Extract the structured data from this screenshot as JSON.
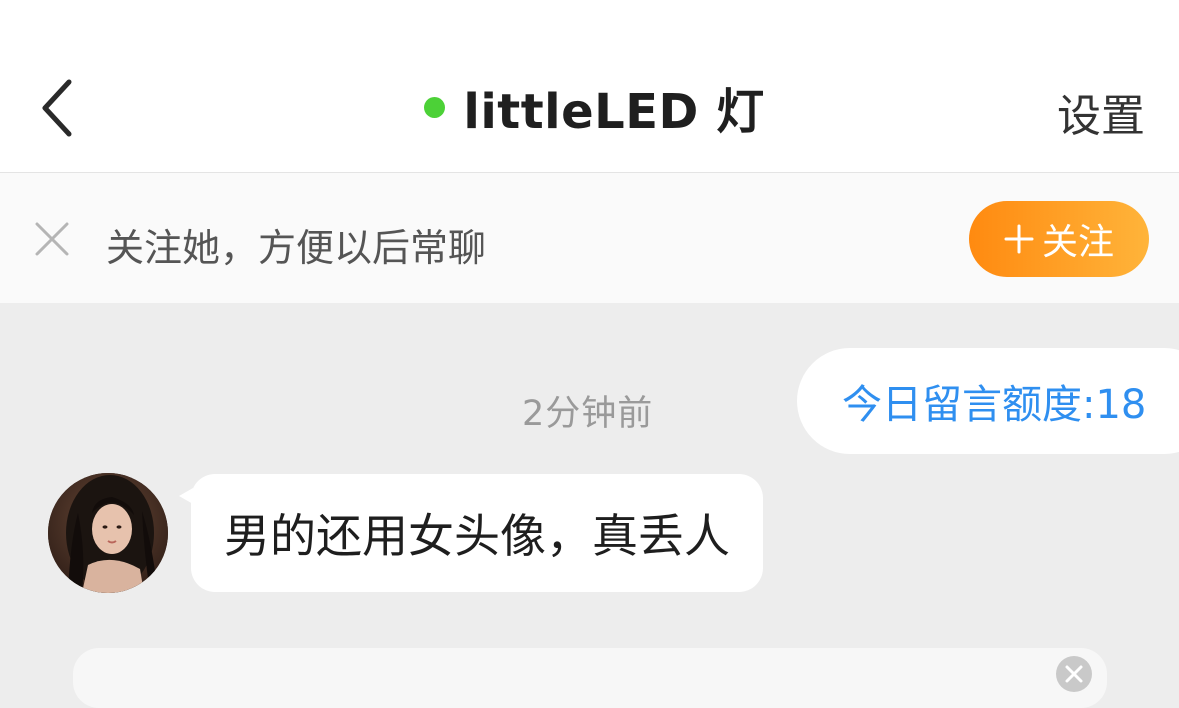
{
  "header": {
    "title": "littleLED 灯",
    "settings_label": "设置",
    "online_color": "#4cd137",
    "back_icon": "chevron-left-icon"
  },
  "follow_banner": {
    "text": "关注她，方便以后常聊",
    "button_label": "关注",
    "close_icon": "close-icon",
    "plus_icon": "plus-icon"
  },
  "chat": {
    "timestamp": "2分钟前",
    "quota_text": "今日留言额度:18",
    "messages": [
      {
        "sender": "other",
        "text": "男的还用女头像，真丢人"
      }
    ]
  },
  "colors": {
    "accent_orange_start": "#ff8a10",
    "accent_orange_end": "#ffb43a",
    "quota_blue": "#2f8ff0",
    "chat_background": "#ededed"
  }
}
